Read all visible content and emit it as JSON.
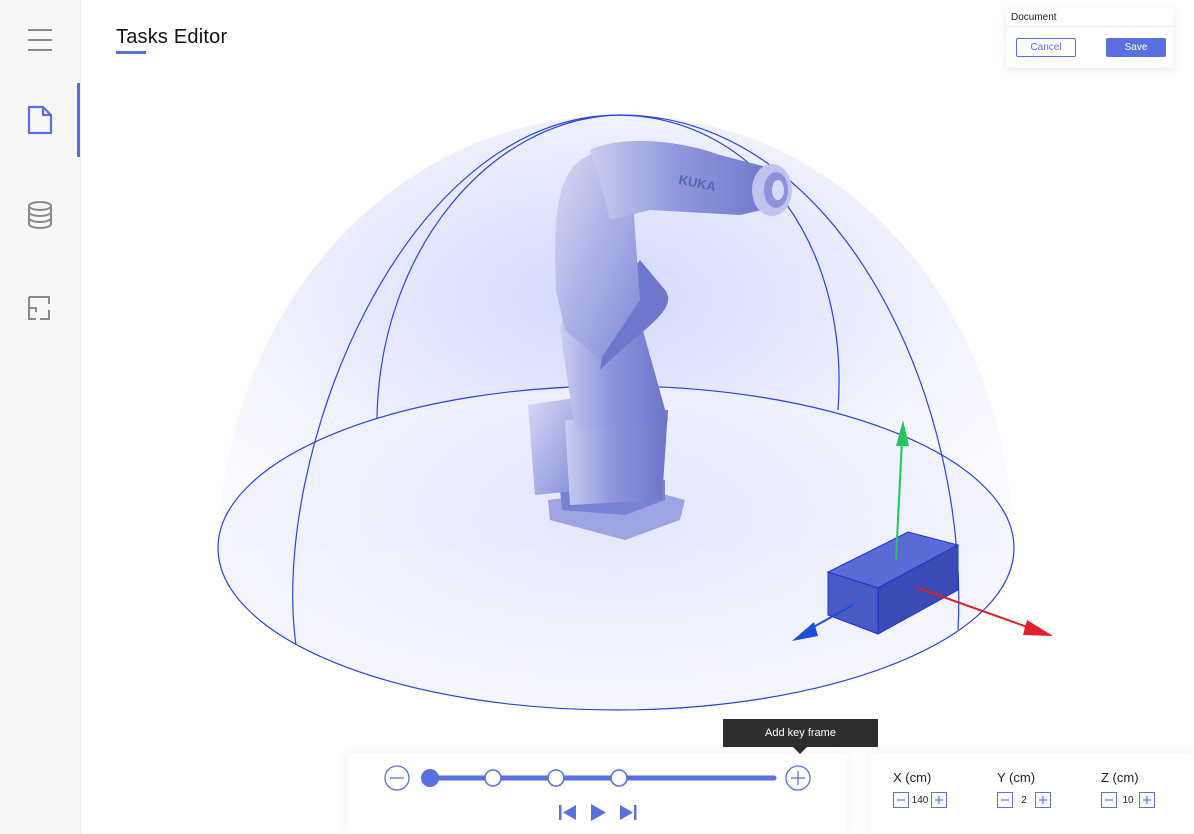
{
  "page": {
    "title": "Tasks Editor"
  },
  "sidebar": {
    "items": [
      {
        "icon": "menu-icon",
        "active": false
      },
      {
        "icon": "document-icon",
        "active": true
      },
      {
        "icon": "database-icon",
        "active": false
      },
      {
        "icon": "floorplan-icon",
        "active": false
      }
    ]
  },
  "document_panel": {
    "label": "Document",
    "cancel_label": "Cancel",
    "save_label": "Save"
  },
  "scene": {
    "robot_brand": "KUKA"
  },
  "timeline": {
    "tooltip": "Add key frame",
    "keyframe_count": 4,
    "zoom_out_icon": "minus-circle-icon",
    "add_icon": "plus-circle-icon",
    "controls": [
      "skip-back-icon",
      "play-icon",
      "skip-forward-icon"
    ]
  },
  "coordinates": {
    "x": {
      "label": "X (cm)",
      "value": "140"
    },
    "y": {
      "label": "Y (cm)",
      "value": "2"
    },
    "z": {
      "label": "Z (cm)",
      "value": "10"
    }
  },
  "colors": {
    "accent": "#5a6fe0",
    "axis_x": "#e0202a",
    "axis_y": "#22c55e",
    "axis_z": "#1d4ed8",
    "tooltip_bg": "#2e2e2e"
  }
}
